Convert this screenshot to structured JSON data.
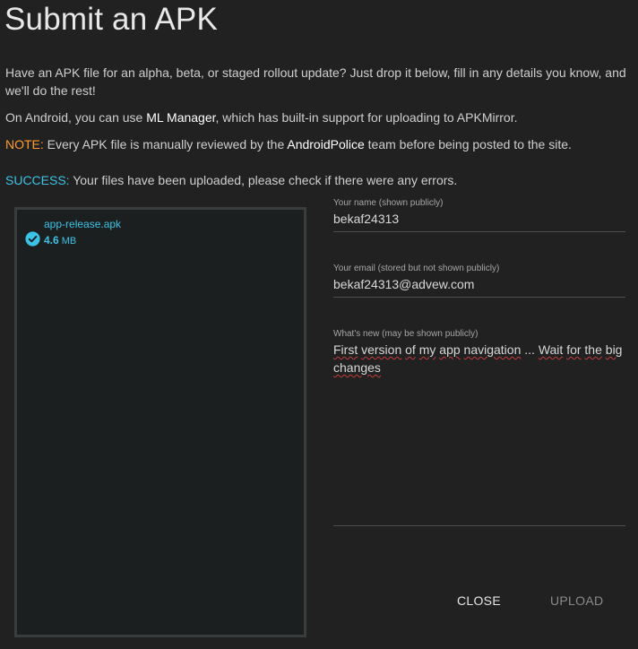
{
  "dialog": {
    "title": "Submit an APK",
    "intro": "Have an APK file for an alpha, beta, or staged rollout update? Just drop it below, fill in any details you know, and we'll do the rest!",
    "android_prefix": "On Android, you can use ",
    "android_link": "ML Manager",
    "android_suffix": ", which has built-in support for uploading to APKMirror.",
    "note_label": "NOTE:",
    "note_prefix": " Every APK file is manually reviewed by the ",
    "note_team": "AndroidPolice",
    "note_suffix": " team before being posted to the site.",
    "success_label": "SUCCESS:",
    "success_text": " Your files have been uploaded, please check if there were any errors."
  },
  "dropzone": {
    "files": [
      {
        "name": "app-release.apk",
        "size_value": "4.6",
        "size_unit": "MB",
        "status_icon": "check-circle-icon"
      }
    ]
  },
  "form": {
    "name_label": "Your name (shown publicly)",
    "name_value": "bekaf24313",
    "email_label": "Your email (stored but not shown publicly)",
    "email_value": "bekaf24313@advew.com",
    "whatsnew_label": "What's new (may be shown publicly)",
    "whatsnew_words": [
      "First",
      "version",
      "of",
      "my",
      "app",
      "navigation",
      "...",
      "Wait",
      "for",
      "the",
      "big",
      "changes"
    ]
  },
  "actions": {
    "close_label": "CLOSE",
    "upload_label": "UPLOAD"
  },
  "colors": {
    "background": "#212121",
    "accent": "#3cc2e6",
    "note": "#ff9d2e"
  }
}
